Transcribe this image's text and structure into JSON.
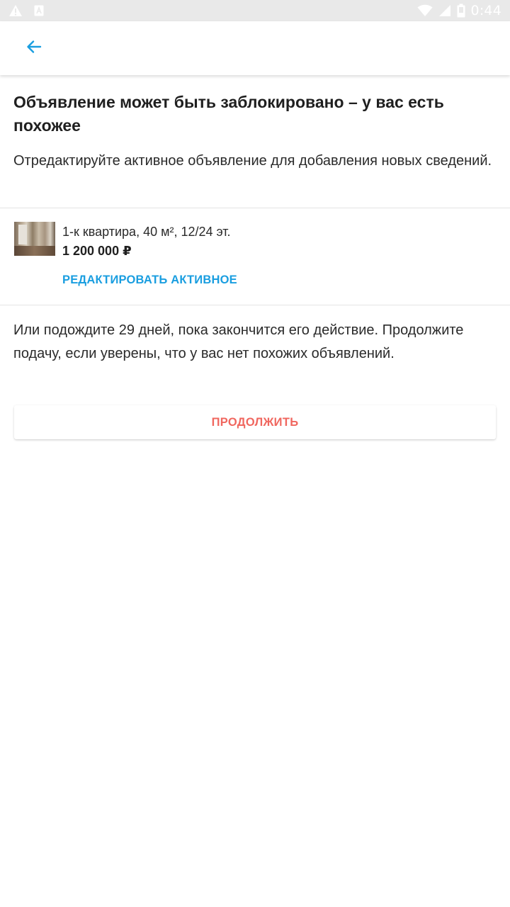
{
  "status_bar": {
    "time": "0:44",
    "icons": [
      "warning-icon",
      "a-badge-icon",
      "wifi-icon",
      "cellular-signal-icon",
      "battery-icon"
    ]
  },
  "toolbar": {
    "back_icon": "arrow-left-icon"
  },
  "main": {
    "title": "Объявление может быть заблокировано – у вас есть похожее",
    "subtitle": "Отредактируйте активное объявление для добавления новых сведений."
  },
  "listing": {
    "description": "1-к квартира, 40 м², 12/24 эт.",
    "price": "1 200 000 ₽",
    "edit_label": "РЕДАКТИРОВАТЬ АКТИВНОЕ"
  },
  "footer": {
    "wait_text": "Или подождите 29 дней, пока закончится его действие. Продолжите подачу, если уверены, что у вас нет похожих объявлений.",
    "continue_label": "ПРОДОЛЖИТЬ"
  },
  "colors": {
    "accent_blue": "#1a9ee0",
    "accent_red": "#f0675f",
    "status_bar_bg": "#e9e9e9"
  }
}
